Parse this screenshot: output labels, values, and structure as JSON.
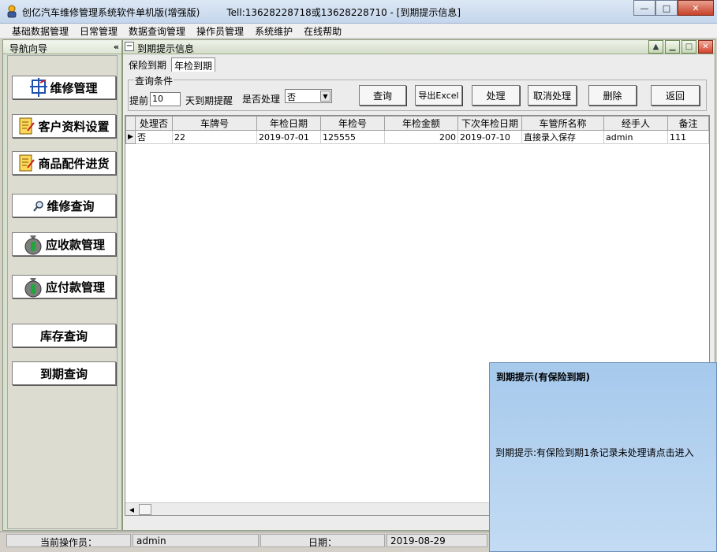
{
  "window": {
    "title": "创亿汽车维修管理系统软件单机版(增强版)",
    "contact": "Tell:13628228718或13628228710 - [到期提示信息]",
    "minimize": "—",
    "maximize": "□",
    "close": "✕"
  },
  "menu": [
    "基础数据管理",
    "日常管理",
    "数据查询管理",
    "操作员管理",
    "系统维护",
    "在线帮助"
  ],
  "nav": {
    "title": "导航向导",
    "collapse": "«",
    "buttons": [
      {
        "label": "维修管理",
        "icon": "repair-icon"
      },
      {
        "label": "客户资料设置",
        "icon": "customer-icon"
      },
      {
        "label": "商品配件进货",
        "icon": "parts-icon"
      },
      {
        "label": "维修查询",
        "icon": "query-icon"
      },
      {
        "label": "应收款管理",
        "icon": "money-bag-icon"
      },
      {
        "label": "应付款管理",
        "icon": "money-bag-icon"
      },
      {
        "label": "库存查询",
        "icon": ""
      },
      {
        "label": "到期查询",
        "icon": ""
      }
    ]
  },
  "child": {
    "title": "到期提示信息",
    "tabs": [
      "保险到期",
      "年检到期"
    ],
    "active_tab": "年检到期",
    "query": {
      "legend": "查询条件",
      "advance_label": "提前",
      "advance_value": "10",
      "days_label": "天到期提醒",
      "handled_label": "是否处理",
      "handled_value": "否"
    },
    "buttons": {
      "query": "查询",
      "export": "导出Excel",
      "process": "处理",
      "cancel": "取消处理",
      "delete": "删除",
      "back": "返回"
    },
    "table": {
      "columns": [
        "处理否",
        "车牌号",
        "年检日期",
        "年检号",
        "年检金额",
        "下次年检日期",
        "车管所名称",
        "经手人",
        "备注"
      ],
      "rows": [
        [
          "否",
          "22",
          "2019-07-01",
          "125555",
          "200",
          "2019-07-10",
          "直接录入保存",
          "admin",
          "111"
        ]
      ],
      "row_marker": "▶"
    }
  },
  "status": {
    "operator_label": "当前操作员：",
    "operator": "admin",
    "date_label": "日期：",
    "date": "2019-08-29"
  },
  "popup": {
    "title": "到期提示(有保险到期)",
    "message": "到期提示:有保险到期1条记录未处理请点击进入"
  }
}
